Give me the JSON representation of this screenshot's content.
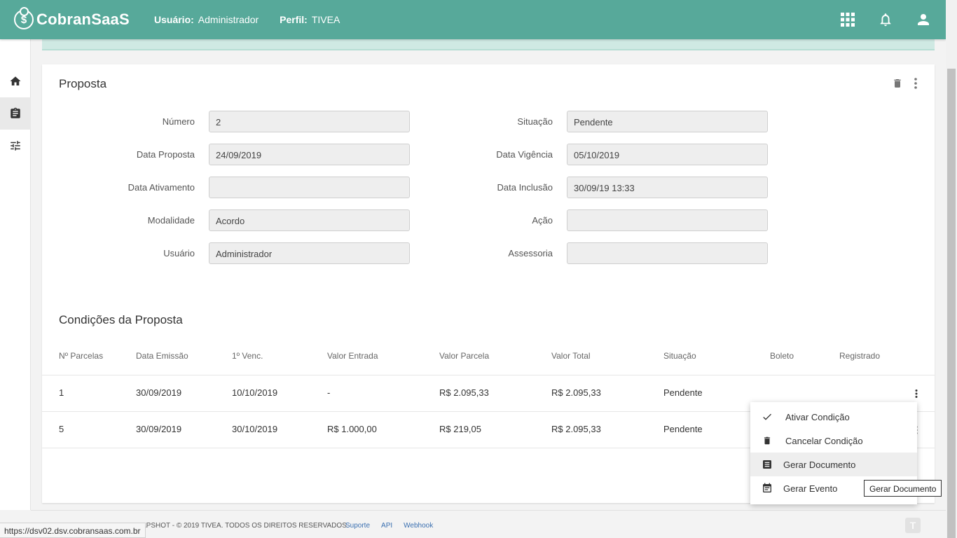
{
  "header": {
    "brand": "CobranSaaS",
    "user_label": "Usuário:",
    "user_value": "Administrador",
    "profile_label": "Perfil:",
    "profile_value": "TIVEA"
  },
  "proposal": {
    "title": "Proposta",
    "left_fields": [
      {
        "label": "Número",
        "value": "2"
      },
      {
        "label": "Data Proposta",
        "value": "24/09/2019"
      },
      {
        "label": "Data Ativamento",
        "value": ""
      },
      {
        "label": "Modalidade",
        "value": "Acordo"
      },
      {
        "label": "Usuário",
        "value": "Administrador"
      }
    ],
    "right_fields": [
      {
        "label": "Situação",
        "value": "Pendente"
      },
      {
        "label": "Data Vigência",
        "value": "05/10/2019"
      },
      {
        "label": "Data Inclusão",
        "value": "30/09/19 13:33"
      },
      {
        "label": "Ação",
        "value": ""
      },
      {
        "label": "Assessoria",
        "value": ""
      }
    ]
  },
  "conditions": {
    "title": "Condições da Proposta",
    "columns": [
      "Nº Parcelas",
      "Data Emissão",
      "1º Venc.",
      "Valor Entrada",
      "Valor Parcela",
      "Valor Total",
      "Situação",
      "Boleto",
      "Registrado"
    ],
    "rows": [
      [
        "1",
        "30/09/2019",
        "10/10/2019",
        "-",
        "R$ 2.095,33",
        "R$ 2.095,33",
        "Pendente",
        "",
        ""
      ],
      [
        "5",
        "30/09/2019",
        "30/10/2019",
        "R$ 1.000,00",
        "R$ 219,05",
        "R$ 2.095,33",
        "Pendente",
        "",
        ""
      ]
    ]
  },
  "menu": {
    "items": [
      {
        "label": "Ativar Condição",
        "icon": "check-icon"
      },
      {
        "label": "Cancelar Condição",
        "icon": "trash-icon"
      },
      {
        "label": "Gerar Documento",
        "icon": "document-icon"
      },
      {
        "label": "Gerar Evento",
        "icon": "event-icon"
      }
    ]
  },
  "tooltip": "Gerar Documento",
  "footer": {
    "copyright": "APSHOT - © 2019 TIVEA. TODOS OS DIREITOS RESERVADOS.",
    "links": [
      "Suporte",
      "API",
      "Webhook"
    ]
  },
  "status_url": "https://dsv02.dsv.cobransaas.com.br",
  "colors": {
    "header_bg": "#57a99a",
    "accent_strip": "#cfe9e3",
    "link": "#3a6fb0"
  }
}
